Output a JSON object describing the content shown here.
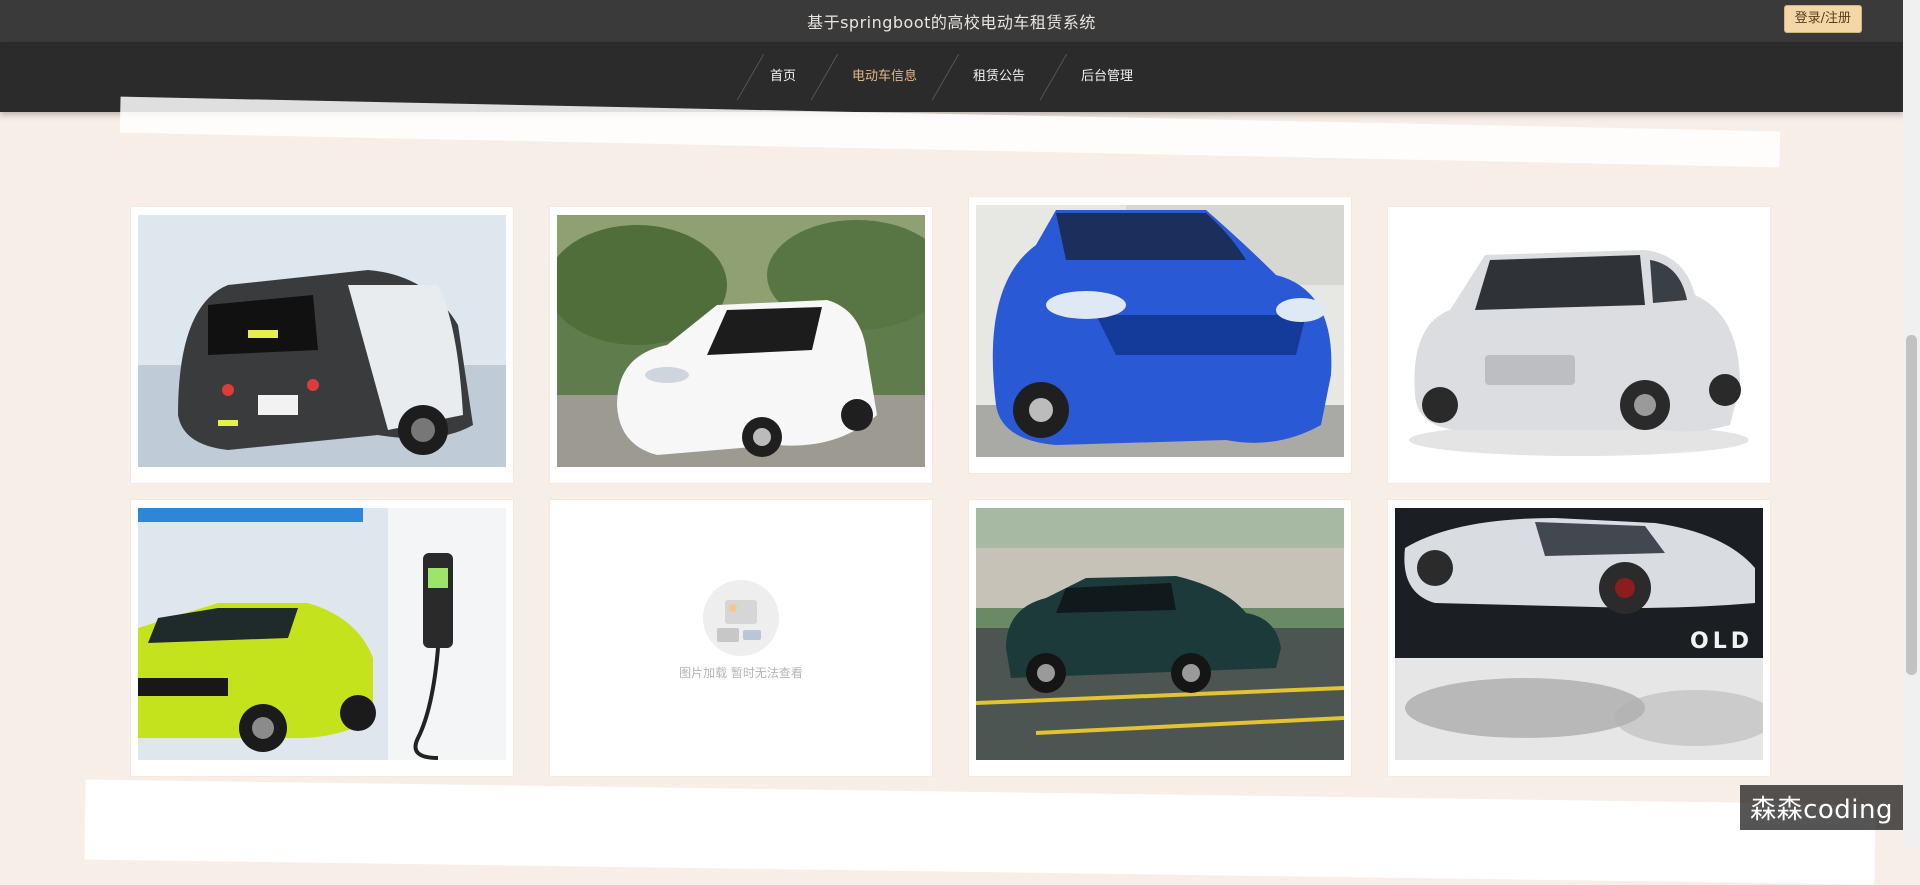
{
  "header": {
    "title": "基于springboot的高校电动车租赁系统",
    "login_label": "登录/注册"
  },
  "nav": {
    "items": [
      {
        "label": "首页"
      },
      {
        "label": "电动车信息",
        "active": true
      },
      {
        "label": "租赁公告"
      },
      {
        "label": "后台管理"
      }
    ]
  },
  "cards": [
    {
      "image": "car-gray-black-rear"
    },
    {
      "image": "car-white-small"
    },
    {
      "image": "car-blue-front"
    },
    {
      "image": "car-silver-boxy"
    },
    {
      "image": "car-lime-green-charging"
    },
    {
      "image": "image-placeholder",
      "placeholder_text": "图片加载 暂时无法查看"
    },
    {
      "image": "car-dark-teal-suv"
    },
    {
      "image": "car-silver-concept-sketch"
    }
  ],
  "watermark": "森森coding"
}
